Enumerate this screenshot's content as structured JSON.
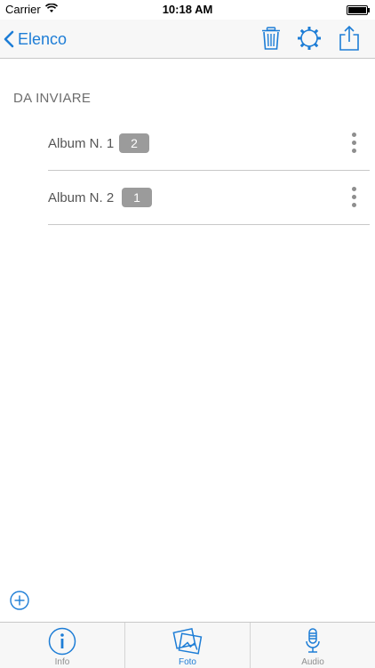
{
  "status": {
    "carrier": "Carrier",
    "time": "10:18 AM"
  },
  "nav": {
    "back_label": "Elenco"
  },
  "section": {
    "title": "DA INVIARE"
  },
  "albums": [
    {
      "label": "Album N. 1",
      "count": "2"
    },
    {
      "label": "Album N. 2",
      "count": "1"
    }
  ],
  "tabs": [
    {
      "label": "Info",
      "icon": "info-icon",
      "active": false
    },
    {
      "label": "Foto",
      "icon": "photos-icon",
      "active": true
    },
    {
      "label": "Audio",
      "icon": "microphone-icon",
      "active": false
    }
  ],
  "colors": {
    "accent": "#1d7dd6",
    "badge": "#9b9b9b"
  }
}
